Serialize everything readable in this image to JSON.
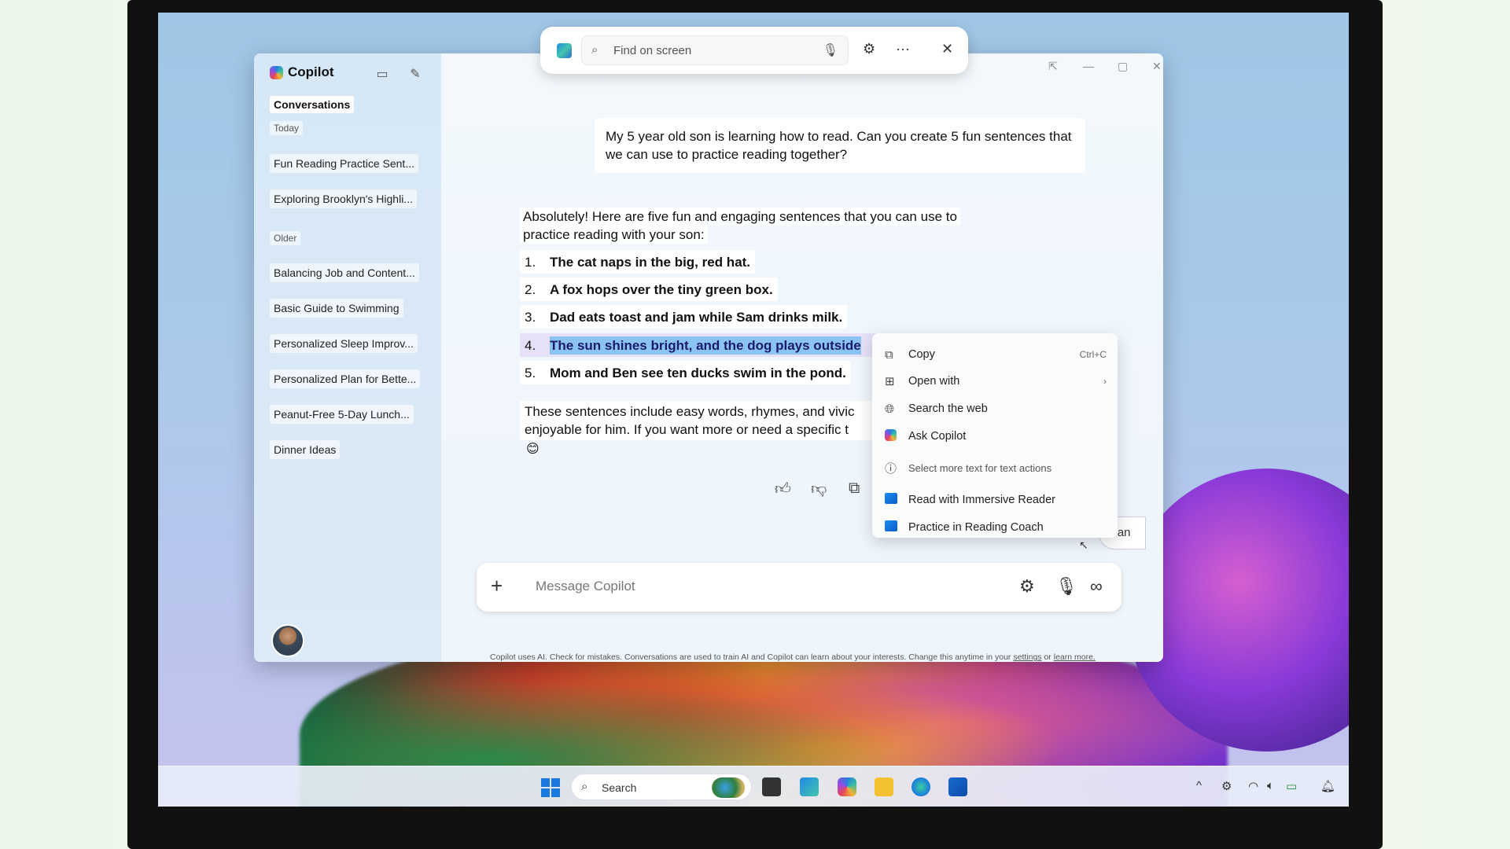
{
  "findbar": {
    "placeholder": "Find on screen"
  },
  "sidebar": {
    "brand": "Copilot",
    "section_title": "Conversations",
    "groups": {
      "today": "Today",
      "older": "Older"
    },
    "today_items": [
      {
        "label": "Fun Reading Practice Sent..."
      },
      {
        "label": "Exploring Brooklyn's Highli..."
      }
    ],
    "older_items": [
      {
        "label": "Balancing Job and Content..."
      },
      {
        "label": "Basic Guide to Swimming"
      },
      {
        "label": "Personalized Sleep Improv..."
      },
      {
        "label": "Personalized Plan for Bette..."
      },
      {
        "label": "Peanut-Free 5-Day Lunch..."
      },
      {
        "label": "Dinner Ideas"
      }
    ]
  },
  "chat": {
    "user_message": "My 5 year old son is learning how to read. Can you create 5 fun sentences that we can use to practice reading together?",
    "assistant_intro": "Absolutely! Here are five fun and engaging sentences that you can use to practice reading with your son:",
    "sentences": [
      {
        "num": "1.",
        "text": "The cat naps in the big, red hat."
      },
      {
        "num": "2.",
        "text": "A fox hops over the tiny green box."
      },
      {
        "num": "3.",
        "text": "Dad eats toast and jam while Sam drinks milk."
      },
      {
        "num": "4.",
        "text": "The sun shines bright, and the dog plays outside"
      },
      {
        "num": "5.",
        "text": "Mom and Ben see ten ducks swim in the pond."
      }
    ],
    "outro_line1": "These sentences include easy words, rhymes, and vivic",
    "outro_line2": "enjoyable for him. If you want more or need a specific t",
    "emoji": "😊",
    "suggestion_chip": "Can"
  },
  "composer": {
    "placeholder": "Message Copilot"
  },
  "footer": {
    "text": "Copilot uses AI. Check for mistakes. Conversations are used to train AI and Copilot can learn about your interests. Change this anytime in your",
    "settings_link": "settings",
    "or_text": "or",
    "learn_more_link": "learn more."
  },
  "context_menu": {
    "items": [
      {
        "label": "Copy",
        "shortcut": "Ctrl+C",
        "icon": "copy-icon"
      },
      {
        "label": "Open with",
        "icon": "open-with-icon"
      },
      {
        "label": "Search the web",
        "icon": "globe-icon"
      },
      {
        "label": "Ask Copilot",
        "icon": "copilot-icon"
      },
      {
        "label": "Select more text for text actions",
        "icon": "info-icon"
      },
      {
        "label": "Read with Immersive Reader",
        "icon": "immersive-reader-icon"
      },
      {
        "label": "Practice in Reading Coach",
        "icon": "reading-coach-icon"
      }
    ]
  },
  "taskbar": {
    "search_label": "Search"
  },
  "colors": {
    "selection": "#8bc3f2",
    "accent": "#1a78e0"
  }
}
